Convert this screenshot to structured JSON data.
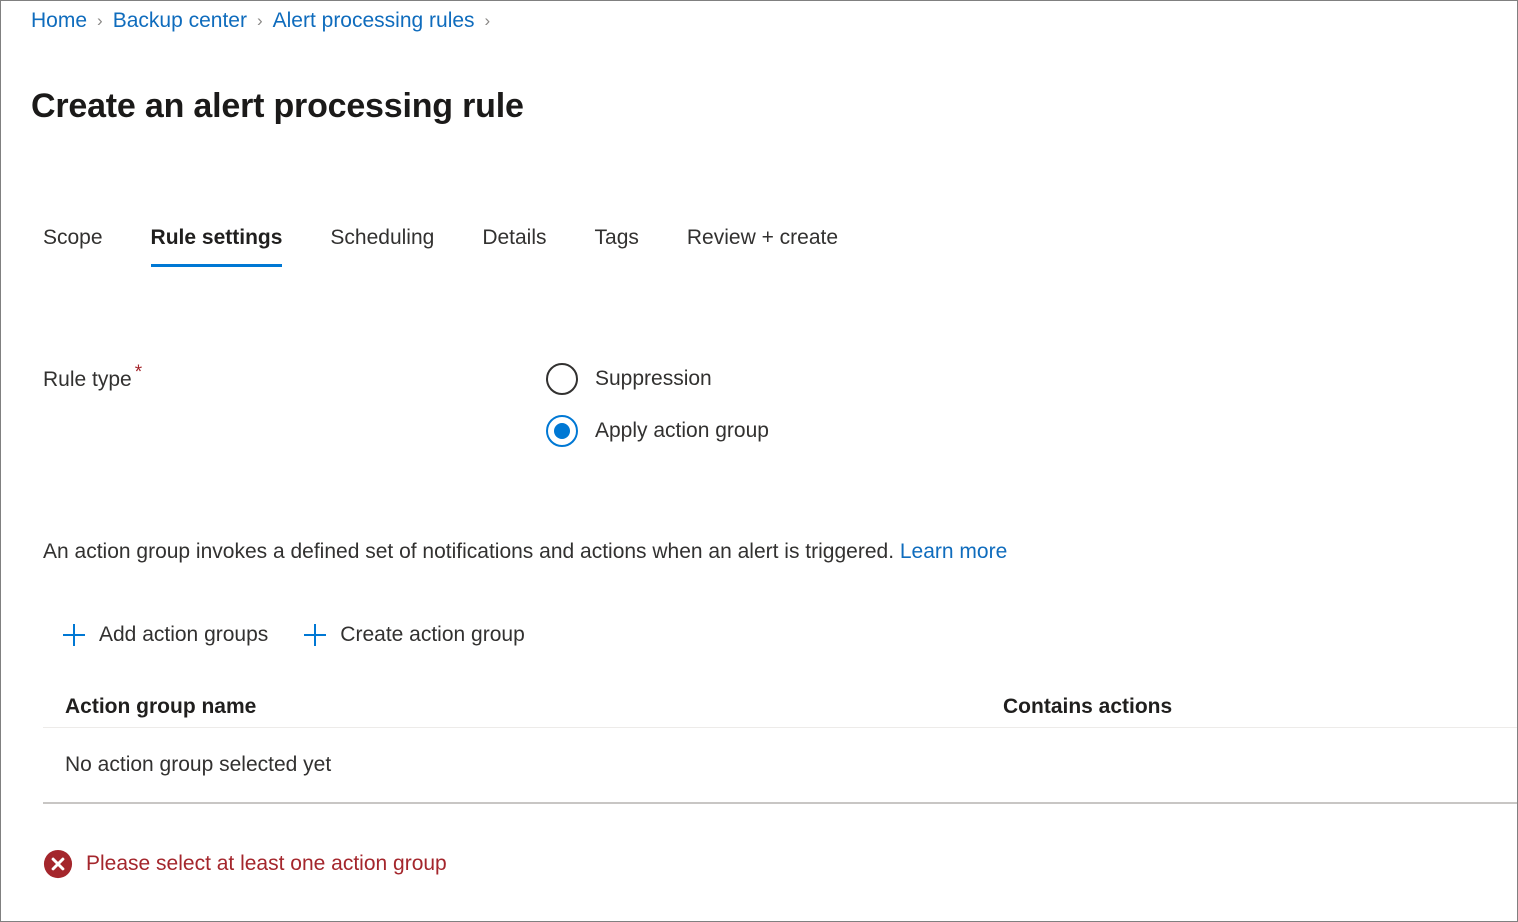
{
  "breadcrumb": {
    "separator": "›",
    "items": [
      {
        "label": "Home"
      },
      {
        "label": "Backup center"
      },
      {
        "label": "Alert processing rules"
      }
    ],
    "trailing_separator": "›"
  },
  "page": {
    "title": "Create an alert processing rule"
  },
  "tabs": [
    {
      "label": "Scope",
      "active": false
    },
    {
      "label": "Rule settings",
      "active": true
    },
    {
      "label": "Scheduling",
      "active": false
    },
    {
      "label": "Details",
      "active": false
    },
    {
      "label": "Tags",
      "active": false
    },
    {
      "label": "Review + create",
      "active": false
    }
  ],
  "rule_type": {
    "label": "Rule type",
    "required_marker": "*",
    "options": [
      {
        "label": "Suppression",
        "selected": false
      },
      {
        "label": "Apply action group",
        "selected": true
      }
    ]
  },
  "description": {
    "text": "An action group invokes a defined set of notifications and actions when an alert is triggered.",
    "link_label": "Learn more"
  },
  "commands": [
    {
      "label": "Add action groups",
      "icon": "plus-icon"
    },
    {
      "label": "Create action group",
      "icon": "plus-icon"
    }
  ],
  "grid": {
    "columns": [
      {
        "label": "Action group name"
      },
      {
        "label": "Contains actions"
      }
    ],
    "empty_message": "No action group selected yet"
  },
  "validation": {
    "icon": "error-circle-x-icon",
    "message": "Please select at least one action group"
  },
  "colors": {
    "accent": "#0078d4",
    "link": "#0f6cbd",
    "error": "#a4262c",
    "text": "#323130",
    "border": "#c8c6c4",
    "divider": "#edebe9",
    "page_border": "#808080"
  }
}
